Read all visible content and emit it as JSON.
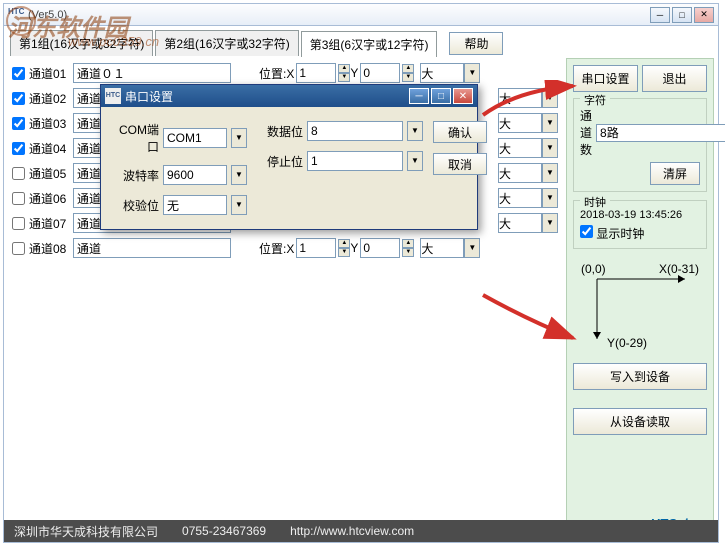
{
  "window": {
    "title": "(Ver5.0)"
  },
  "tabs": [
    {
      "label": "第1组(16汉字或32字符)"
    },
    {
      "label": "第2组(16汉字或32字符)"
    },
    {
      "label": "第3组(6汉字或12字符)"
    }
  ],
  "help_label": "帮助",
  "position_label": "位置:X",
  "y_label": "Y",
  "channels": [
    {
      "chk": true,
      "label": "通道01",
      "value": "通道０１",
      "x": "1",
      "y": "0",
      "size": "大"
    },
    {
      "chk": true,
      "label": "通道02",
      "value": "通道",
      "x": "",
      "y": "",
      "size": "大"
    },
    {
      "chk": true,
      "label": "通道03",
      "value": "通道",
      "x": "",
      "y": "",
      "size": "大"
    },
    {
      "chk": true,
      "label": "通道04",
      "value": "通道",
      "x": "",
      "y": "",
      "size": "大"
    },
    {
      "chk": false,
      "label": "通道05",
      "value": "通道",
      "x": "",
      "y": "",
      "size": "大"
    },
    {
      "chk": false,
      "label": "通道06",
      "value": "通道",
      "x": "",
      "y": "",
      "size": "大"
    },
    {
      "chk": false,
      "label": "通道07",
      "value": "通道",
      "x": "",
      "y": "",
      "size": "大"
    },
    {
      "chk": false,
      "label": "通道08",
      "value": "通道",
      "x": "1",
      "y": "0",
      "size": "大"
    }
  ],
  "right": {
    "serial_btn": "串口设置",
    "exit_btn": "退出",
    "chars_group": "字符",
    "channel_count_label": "通道数",
    "channel_count_value": "8路",
    "clear_btn": "清屏",
    "clock_group": "时钟",
    "clock_value": "2018-03-19 13:45:26",
    "show_clock": "显示时钟",
    "coord_origin": "(0,0)",
    "coord_x": "X(0-31)",
    "coord_y": "Y(0-29)",
    "write_btn": "写入到设备",
    "read_btn": "从设备读取",
    "logo": "HTC",
    "logo_suffix": "view"
  },
  "dialog": {
    "title": "串口设置",
    "com_port_label": "COM端口",
    "com_port_value": "COM1",
    "baud_label": "波特率",
    "baud_value": "9600",
    "parity_label": "校验位",
    "parity_value": "无",
    "data_bits_label": "数据位",
    "data_bits_value": "8",
    "stop_bits_label": "停止位",
    "stop_bits_value": "1",
    "ok_btn": "确认",
    "cancel_btn": "取消"
  },
  "status": {
    "company": "深圳市华天成科技有限公司",
    "phone": "0755-23467369",
    "url": "http://www.htcview.com"
  },
  "watermark": {
    "text": "河东软件园",
    "url": "www.pc0359.cn"
  }
}
